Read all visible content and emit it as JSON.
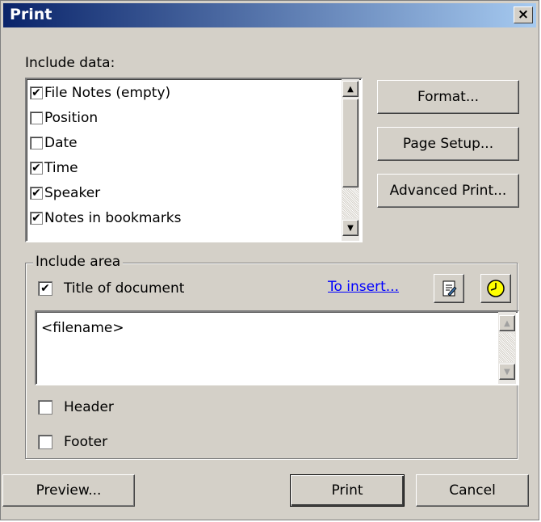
{
  "window": {
    "title": "Print",
    "close_label": "×"
  },
  "include_data": {
    "label": "Include data:",
    "items": [
      {
        "label": "File Notes   (empty)",
        "checked": true
      },
      {
        "label": "Position",
        "checked": false
      },
      {
        "label": "Date",
        "checked": false
      },
      {
        "label": "Time",
        "checked": true
      },
      {
        "label": "Speaker",
        "checked": true
      },
      {
        "label": "Notes in bookmarks",
        "checked": true
      }
    ]
  },
  "side_buttons": {
    "format": "Format...",
    "page_setup": "Page Setup...",
    "advanced_print": "Advanced Print..."
  },
  "include_area": {
    "label": "Include area",
    "title_label": "Title of document",
    "title_checked": true,
    "to_insert": "To insert...",
    "text_value": "<filename>",
    "header_label": "Header",
    "header_checked": false,
    "footer_label": "Footer",
    "footer_checked": false
  },
  "bottom_buttons": {
    "preview": "Preview...",
    "print": "Print",
    "cancel": "Cancel"
  },
  "icons": {
    "check": "✔",
    "up": "▲",
    "down": "▼"
  }
}
